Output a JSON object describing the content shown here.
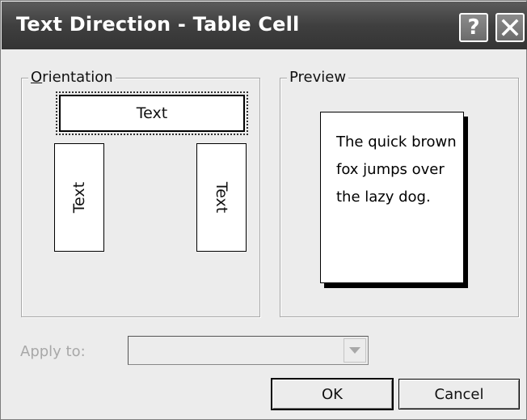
{
  "window": {
    "title": "Text Direction - Table Cell",
    "help_glyph": "?",
    "close_icon": "close-icon"
  },
  "orientation": {
    "legend_mnemonic": "O",
    "legend_rest": "rientation",
    "options": [
      {
        "label": "Text",
        "direction": "horizontal",
        "selected": true
      },
      {
        "label": "Text",
        "direction": "vertical-bottom-to-top",
        "selected": false
      },
      {
        "label": "Text",
        "direction": "vertical-top-to-bottom",
        "selected": false
      }
    ]
  },
  "preview": {
    "legend": "Preview",
    "lines": [
      "The quick brown",
      "fox jumps over",
      "the lazy dog."
    ]
  },
  "apply": {
    "label": "Apply to:",
    "value": ""
  },
  "buttons": {
    "ok": "OK",
    "cancel": "Cancel"
  }
}
